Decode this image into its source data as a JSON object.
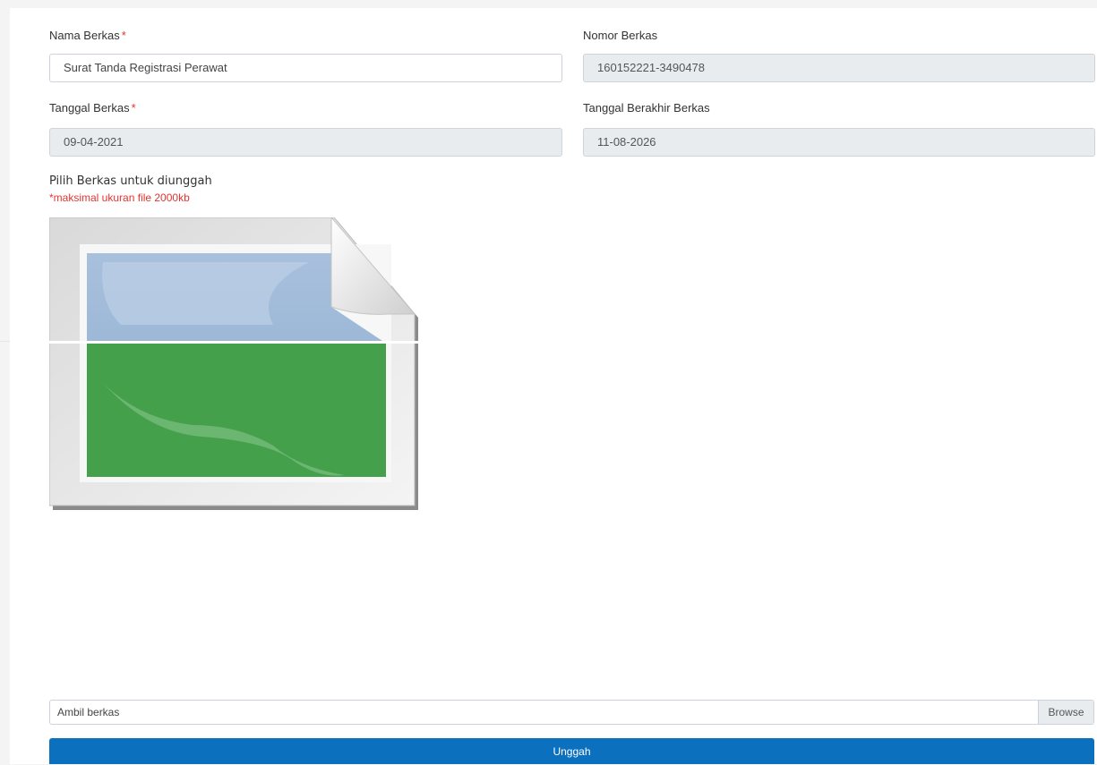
{
  "form": {
    "nama_berkas": {
      "label": "Nama Berkas",
      "required_mark": "*",
      "value": "Surat Tanda Registrasi Perawat"
    },
    "nomor_berkas": {
      "label": "Nomor Berkas",
      "value": "160152221-3490478"
    },
    "tanggal_berkas": {
      "label": "Tanggal Berkas",
      "required_mark": "*",
      "value": "09-04-2021"
    },
    "tanggal_berakhir": {
      "label": "Tanggal Berakhir Berkas",
      "value": "11-08-2026"
    }
  },
  "upload": {
    "title": "Pilih Berkas untuk diunggah",
    "note": "*maksimal ukuran file 2000kb",
    "preview_icon": "image-placeholder-icon",
    "file_placeholder": "Ambil berkas",
    "browse_label": "Browse",
    "submit_label": "Unggah"
  },
  "colors": {
    "primary": "#0b70be",
    "required": "#e3342f",
    "readonly_bg": "#e9ecef"
  }
}
